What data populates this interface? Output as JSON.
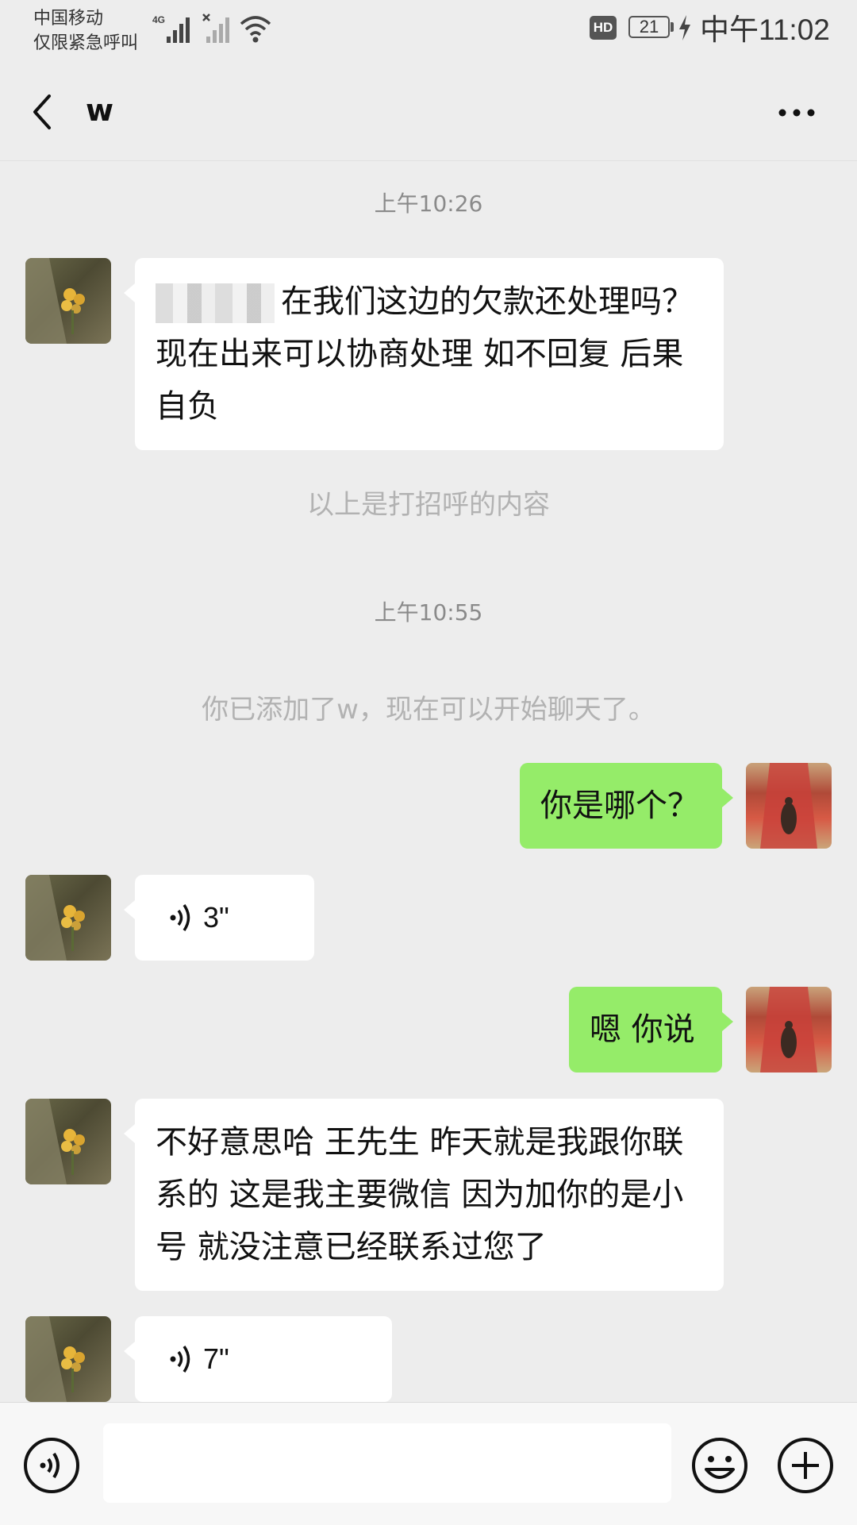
{
  "status_bar": {
    "carrier_line1": "中国移动",
    "carrier_line2": "仅限紧急呼叫",
    "network": "4G",
    "hd_badge": "HD",
    "battery": "21",
    "time": "中午11:02"
  },
  "header": {
    "title": "w",
    "back_icon": "back-chevron-icon",
    "more_icon": "more-dots-icon"
  },
  "chat": {
    "time1": "上午10:26",
    "msg1": "在我们这边的欠款还处理吗？现在出来可以协商处理 如不回复 后果自负",
    "notice1": "以上是打招呼的内容",
    "time2": "上午10:55",
    "notice2": "你已添加了w，现在可以开始聊天了。",
    "msg2": "你是哪个？",
    "voice1": "3\"",
    "msg3": "嗯 你说",
    "msg4": "不好意思哈 王先生 昨天就是我跟你联系的 这是我主要微信 因为加你的是小号 就没注意已经联系过您了",
    "voice2": "7\""
  },
  "input_bar": {
    "voice_icon": "voice-input-icon",
    "emoji_icon": "emoji-icon",
    "plus_icon": "plus-icon",
    "text_value": ""
  },
  "colors": {
    "background": "#ededed",
    "outgoing_bubble": "#95ec69",
    "incoming_bubble": "#ffffff",
    "system_text": "#b2b2b2"
  }
}
